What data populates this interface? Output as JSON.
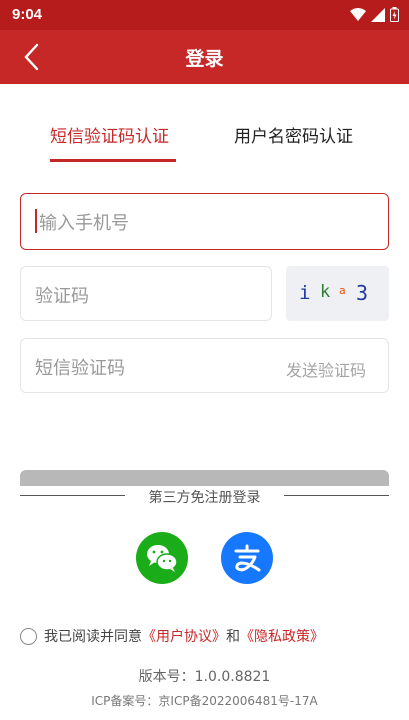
{
  "status_bar": {
    "time": "9:04"
  },
  "app_bar": {
    "title": "登录"
  },
  "tabs": [
    {
      "label": "短信验证码认证",
      "active": true
    },
    {
      "label": "用户名密码认证",
      "active": false
    }
  ],
  "form": {
    "phone_placeholder": "输入手机号",
    "captcha_placeholder": "验证码",
    "captcha_chars": [
      "i",
      "k",
      "a",
      "3"
    ],
    "sms_placeholder": "短信验证码",
    "send_code_label": "发送验证码"
  },
  "third_party": {
    "title": "第三方免注册登录",
    "providers": [
      "wechat-icon",
      "alipay-icon"
    ]
  },
  "agreement": {
    "prefix": "我已阅读并同意",
    "user_agreement": "《用户协议》",
    "and": "和",
    "privacy_policy": "《隐私政策》"
  },
  "footer": {
    "version": "版本号：1.0.0.8821",
    "icp": "ICP备案号：京ICP备2022006481号-17A"
  },
  "colors": {
    "brand": "#c62828",
    "status_bar": "#b71c1c",
    "wechat": "#1aad19",
    "alipay": "#1677ff"
  }
}
